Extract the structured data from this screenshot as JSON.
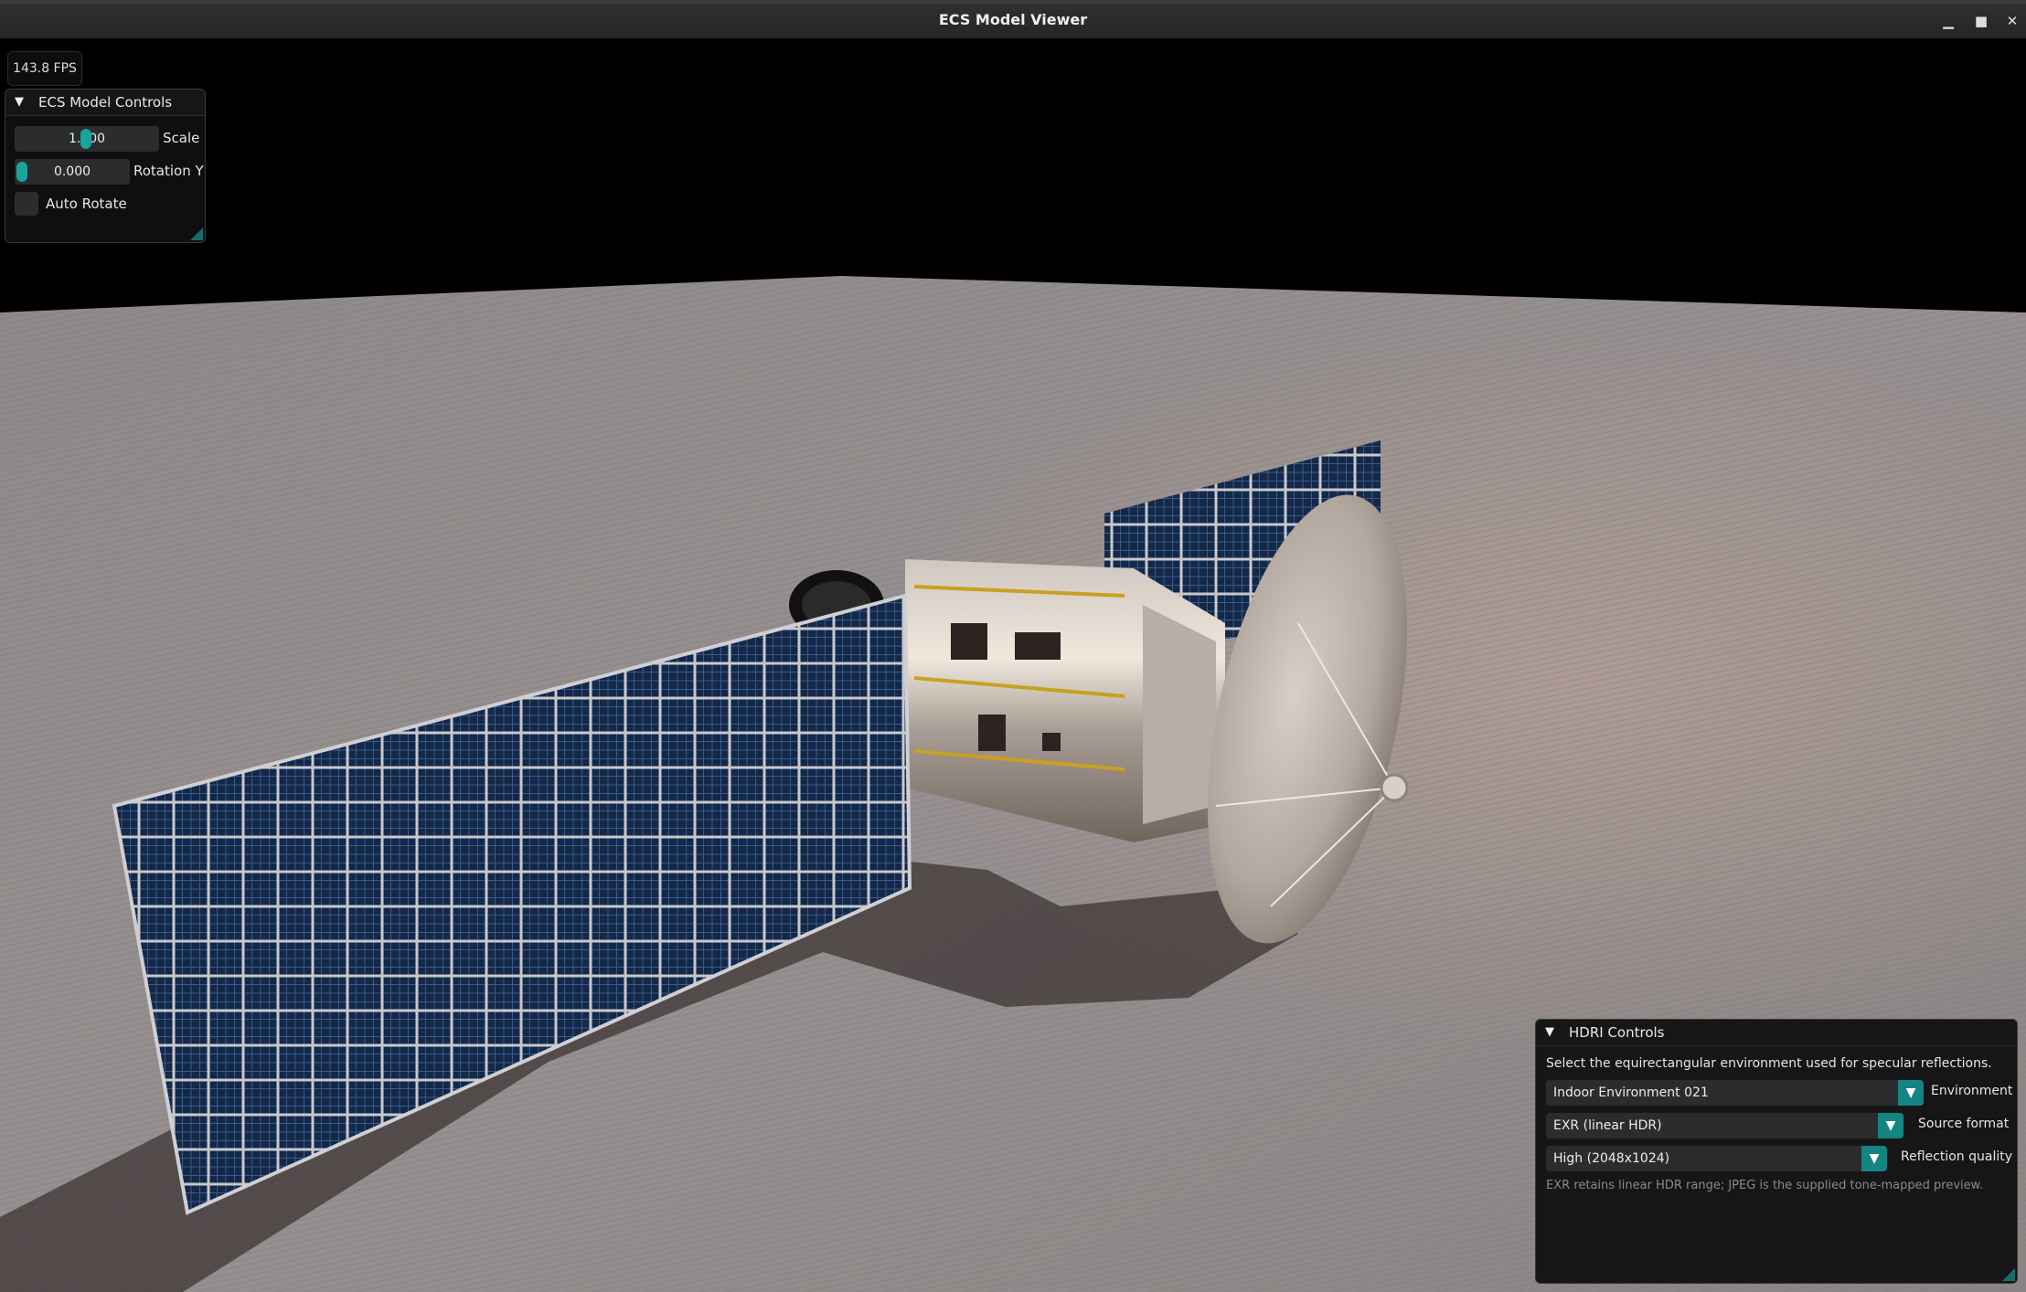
{
  "window": {
    "title": "ECS Model Viewer",
    "minimize_icon": "minimize-icon",
    "maximize_icon": "maximize-icon",
    "close_icon": "close-icon"
  },
  "overlay": {
    "fps": "143.8 FPS"
  },
  "model_controls": {
    "title": "ECS Model Controls",
    "scale": {
      "value": "1.000",
      "label": "Scale"
    },
    "rotation_y": {
      "value": "0.000",
      "label": "Rotation Y"
    },
    "auto_rotate": {
      "label": "Auto Rotate",
      "checked": false
    }
  },
  "hdri_controls": {
    "title": "HDRI Controls",
    "description": "Select the equirectangular environment used for specular reflections.",
    "environment": {
      "value": "Indoor Environment 021",
      "label": "Environment"
    },
    "source_format": {
      "value": "EXR (linear HDR)",
      "label": "Source format"
    },
    "reflection_quality": {
      "value": "High (2048x1024)",
      "label": "Reflection quality"
    },
    "note": "EXR retains linear HDR range; JPEG is the supplied tone-mapped preview."
  },
  "colors": {
    "accent": "#1aa39a",
    "panel_bg": "#101012",
    "floor": "#8e8785",
    "solar_panel": "#0f2a4a"
  }
}
